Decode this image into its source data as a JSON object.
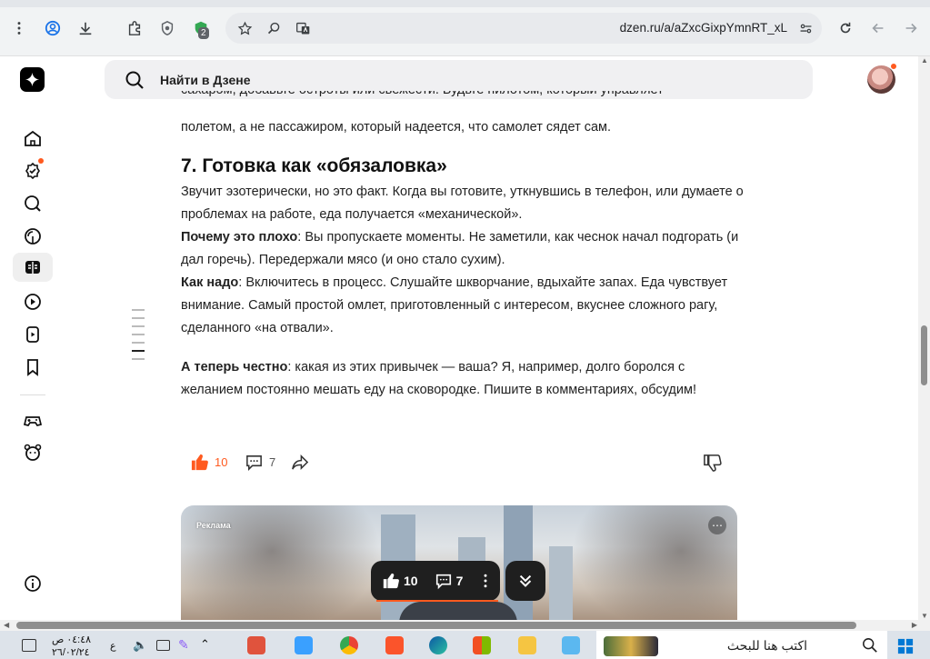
{
  "browser": {
    "url": "dzen.ru/a/aZxcGixpYmnRT_xL",
    "extension_badge": "2"
  },
  "header": {
    "search_placeholder": "Найти в Дзене"
  },
  "article": {
    "prev_line_partial": "сахаром, добавьте остроты или свежести. Будьте пилотом, который управляет",
    "prev_line_end": "полетом, а не пассажиром, который надеется, что самолет сядет сам.",
    "heading": "7. Готовка как «обязаловка»",
    "intro": "Звучит эзотерически, но это факт. Когда вы готовите, уткнувшись в телефон, или думаете о проблемах на работе, еда получается «механической».",
    "why_label": "Почему это плохо",
    "why_text": ": Вы пропускаете моменты. Не заметили, как чеснок начал подгорать (и дал горечь). Передержали мясо (и оно стало сухим).",
    "how_label": "Как надо",
    "how_text": ": Включитесь в процесс. Слушайте шкворчание, вдыхайте запах. Еда чувствует внимание. Самый простой омлет, приготовленный с интересом, вкуснее сложного рагу, сделанного «на отвали».",
    "honest_label": "А теперь честно",
    "honest_text": ": какая из этих привычек — ваша? Я, например, долго боролся с желанием постоянно мешать еду на сковородке. Пишите в комментариях, обсудим!"
  },
  "actions": {
    "likes": "10",
    "comments": "7"
  },
  "ad": {
    "label": "Реклама"
  },
  "floating": {
    "likes": "10",
    "comments": "7"
  },
  "taskbar": {
    "time": "٠٤:٤٨ ص",
    "date": "٢٦/٠٢/٢٤",
    "lang": "ع",
    "search_text": "اكتب هنا للبحث"
  },
  "colors": {
    "accent": "#ff5a1f",
    "text": "#222222"
  }
}
